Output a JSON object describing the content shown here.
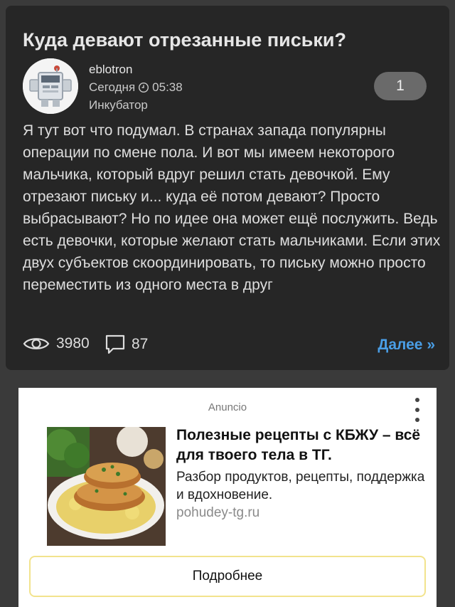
{
  "post": {
    "title": "Куда девают отрезанные письки?",
    "author": "eblotron",
    "date_label": "Сегодня",
    "time": "05:38",
    "category": "Инкубатор",
    "rating": "1",
    "body": "Я тут вот что подумал. В странах запада популярны операции по смене пола. И вот мы имеем некоторого мальчика, который вдруг решил стать девочкой. Ему отрезают письку и... куда её потом девают? Просто выбрасывают? Но по идее она может ещё послужить. Ведь есть девочки, которые желают стать мальчиками. Если этих двух субъектов скоординировать, то письку можно просто переместить из одного места в друг",
    "views": "3980",
    "comments": "87",
    "more_label": "Далее »"
  },
  "ad": {
    "label": "Anuncio",
    "title": "Полезные рецепты с КБЖУ – всё для твоего тела в ТГ.",
    "description": "Разбор продуктов, рецепты, поддержка и вдохновение.",
    "domain": "pohudey-tg.ru",
    "button_label": "Подробнее"
  },
  "icons": {
    "clock": "clock-icon",
    "views": "eye-icon",
    "comments": "speech-bubble-icon",
    "ad_menu": "vertical-dots-icon"
  },
  "colors": {
    "card_bg": "#262626",
    "page_bg": "#3a3a3a",
    "link": "#4a9ee6",
    "rating_bg": "#6a6a6a",
    "ad_button_border": "#f2e38d"
  }
}
